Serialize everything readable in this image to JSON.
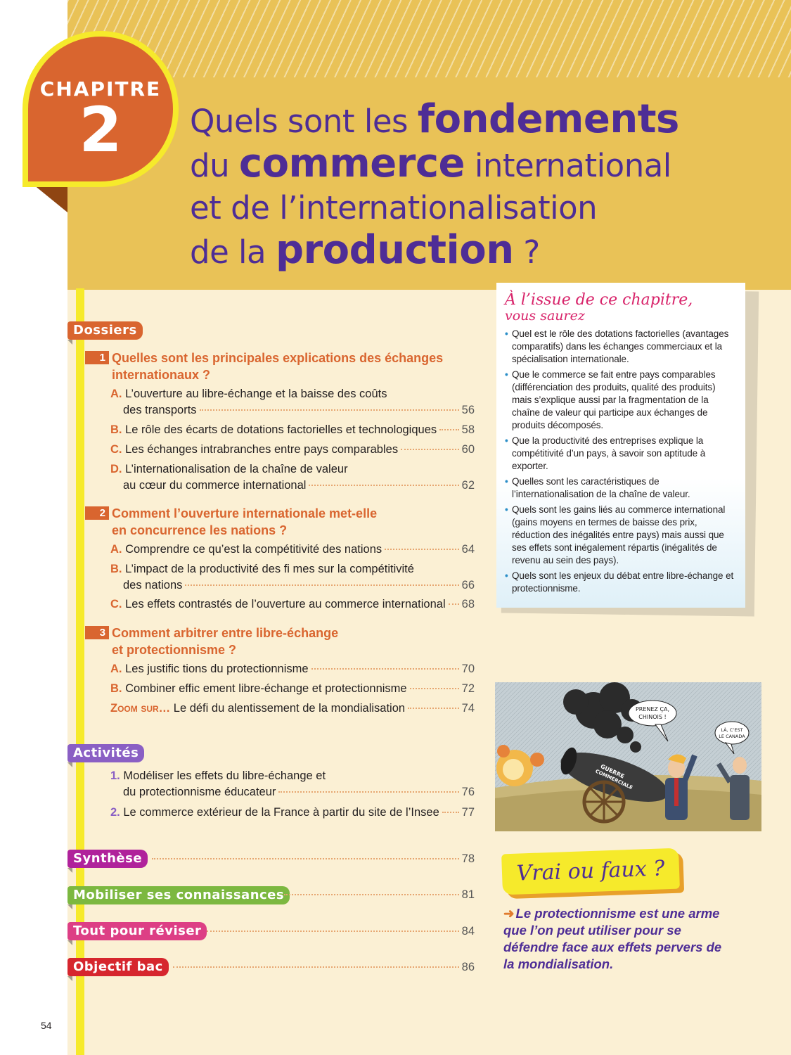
{
  "chapter": {
    "label": "CHAPITRE",
    "number": "2"
  },
  "title": {
    "l1a": "Quels sont les ",
    "l1b": "fondements",
    "l2a": "du ",
    "l2b": "commerce",
    "l2c": " international",
    "l3": "et de l’internationalisation",
    "l4a": "de la ",
    "l4b": "production",
    "l4c": " ?"
  },
  "tabs": {
    "dossiers": "Dossiers",
    "activites": "Activités",
    "synthese": "Synthèse",
    "mobiliser": "Mobiliser ses connaissances",
    "reviser": "Tout pour réviser",
    "bac": "Objectif bac"
  },
  "tab_pages": {
    "synthese": "78",
    "mobiliser": "81",
    "reviser": "84",
    "bac": "86"
  },
  "dossiers": [
    {
      "num": "1",
      "title_l1": "Quelles sont les principales explications des échanges",
      "title_l2": "internationaux ?",
      "items": [
        {
          "letter": "A.",
          "l1": "L’ouverture au libre-échange et la baisse des coûts",
          "l2": "des transports",
          "page": "56"
        },
        {
          "letter": "B.",
          "l1": "",
          "l2": "Le rôle des écarts de dotations factorielles et technologiques",
          "page": "58"
        },
        {
          "letter": "C.",
          "l1": "",
          "l2": "Les échanges intrabranches entre pays comparables",
          "page": "60"
        },
        {
          "letter": "D.",
          "l1": "L’internationalisation de la chaîne de valeur",
          "l2": "au cœur du commerce international",
          "page": "62"
        }
      ]
    },
    {
      "num": "2",
      "title_l1": "Comment l’ouverture internationale met-elle",
      "title_l2": "en concurrence les nations ?",
      "items": [
        {
          "letter": "A.",
          "l1": "",
          "l2": "Comprendre ce qu’est la compétitivité des nations",
          "page": "64"
        },
        {
          "letter": "B.",
          "l1": "L’impact de la productivité des fi mes sur la compétitivité",
          "l2": "des nations",
          "page": "66"
        },
        {
          "letter": "C.",
          "l1": "",
          "l2": "Les effets contrastés de l’ouverture au commerce international",
          "page": "68"
        }
      ]
    },
    {
      "num": "3",
      "title_l1": "Comment arbitrer entre libre-échange",
      "title_l2": "et protectionnisme ?",
      "items": [
        {
          "letter": "A.",
          "l1": "",
          "l2": "Les justific  tions du protectionnisme",
          "page": "70"
        },
        {
          "letter": "B.",
          "l1": "",
          "l2": "Combiner effic    ement libre-échange et protectionnisme",
          "page": "72"
        },
        {
          "letter": "Zoom sur…",
          "l1": "",
          "l2": "Le défi du  alentissement de la mondialisation",
          "page": "74"
        }
      ]
    }
  ],
  "activites": [
    {
      "num": "1.",
      "l1": "Modéliser les effets du libre-échange et",
      "l2": "du protectionnisme éducateur",
      "page": "76"
    },
    {
      "num": "2.",
      "l1": "",
      "l2": "Le commerce extérieur de la France à partir du site de l’Insee",
      "page": "77"
    }
  ],
  "learn": {
    "title_l1": "À l’issue de ce chapitre,",
    "title_l2": "vous saurez",
    "items": [
      "Quel est le rôle des dotations factorielles (avantages comparatifs) dans les échanges commerciaux et la spécialisation internationale.",
      "Que le commerce se fait entre pays comparables (différenciation des produits, qualité des produits) mais s’explique aussi par la fragmentation de la chaîne de valeur qui participe aux échanges de produits décomposés.",
      "Que la productivité des entreprises explique la compétitivité d’un pays, à savoir son aptitude à exporter.",
      "Quelles sont les caractéristiques de l’internationalisation de la chaîne de valeur.",
      "Quels sont les gains liés au commerce international (gains moyens en termes de baisse des prix, réduction des inégalités entre pays) mais aussi que ses effets sont inégalement répartis (inégalités de revenu au sein des pays).",
      "Quels sont les enjeux du débat entre libre-échange et protectionnisme."
    ]
  },
  "cartoon": {
    "bubble1_l1": "PRENEZ ÇA,",
    "bubble1_l2": "CHINOIS !",
    "bubble2_l1": "LÀ, C’EST",
    "bubble2_l2": "LE CANADA",
    "cannon_l1": "GUERRE",
    "cannon_l2": "COMMERCIALE"
  },
  "vrai_faux": {
    "tag": "Vrai ou faux ?",
    "text": "Le protectionnisme est une arme que l’on peut utiliser pour se défendre face aux effets pervers de la mondialisation."
  },
  "page_number": "54",
  "colors": {
    "purple": "#4e2d96",
    "orange": "#d9652f",
    "yellow": "#f6ea2b",
    "gold": "#e9c257",
    "cream": "#fbf0d4",
    "pink": "#d8236a",
    "green": "#7cb840",
    "magenta": "#b0229b",
    "violet": "#8a5fc4",
    "rose": "#dd3f85",
    "red": "#d6262e"
  }
}
